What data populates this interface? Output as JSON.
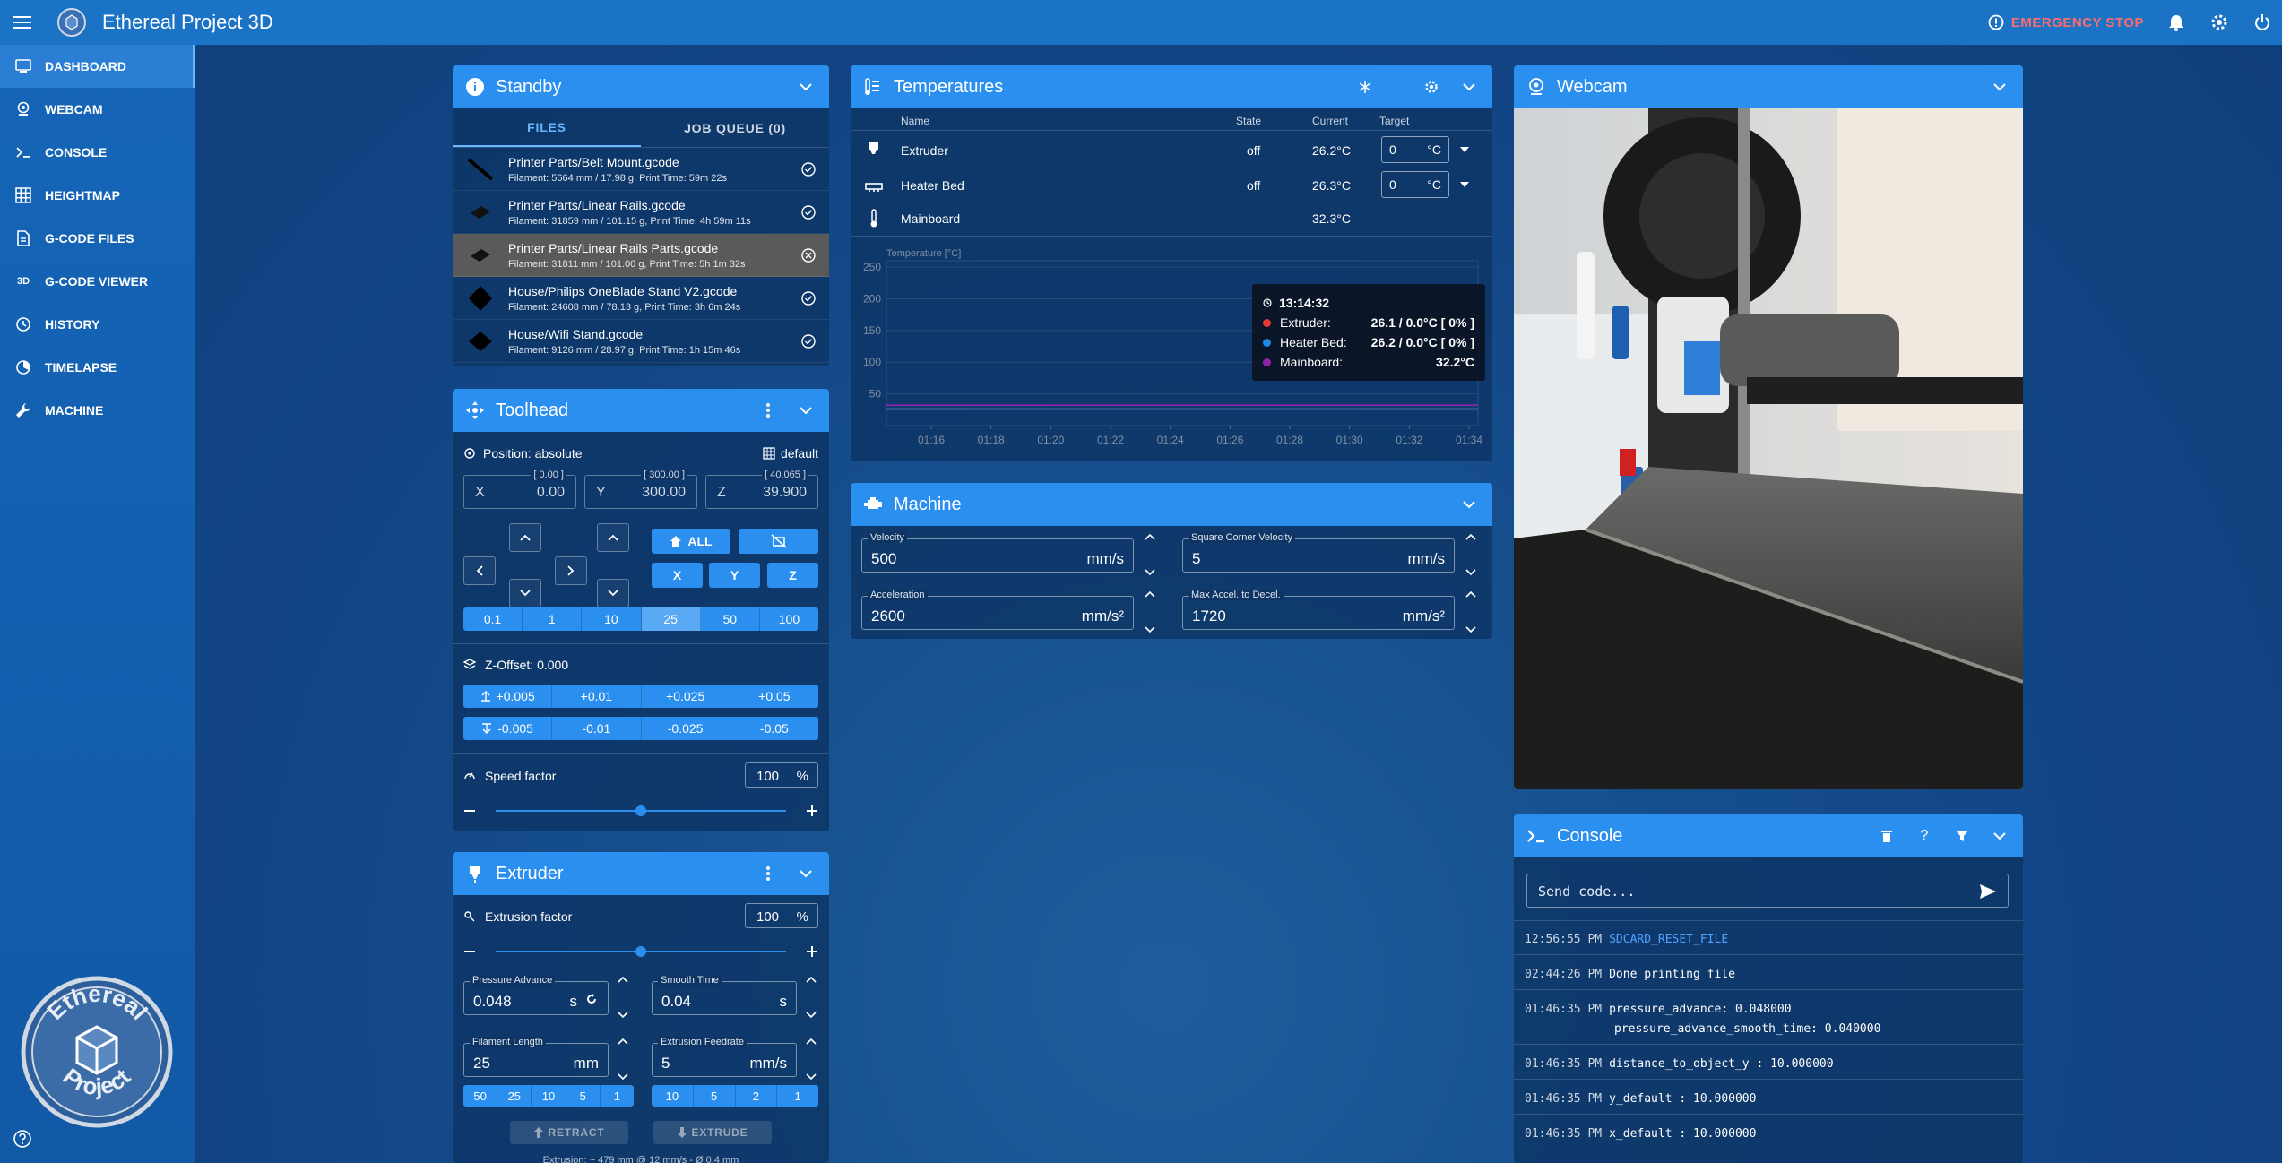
{
  "app": {
    "title": "Ethereal Project 3D",
    "emergency_stop": "EMERGENCY STOP"
  },
  "sidebar": {
    "items": [
      {
        "label": "DASHBOARD",
        "icon": "dashboard-icon"
      },
      {
        "label": "WEBCAM",
        "icon": "webcam-icon"
      },
      {
        "label": "CONSOLE",
        "icon": "console-icon"
      },
      {
        "label": "HEIGHTMAP",
        "icon": "grid-icon"
      },
      {
        "label": "G-CODE FILES",
        "icon": "file-icon"
      },
      {
        "label": "G-CODE VIEWER",
        "icon": "3d-icon",
        "icon_text": "3D"
      },
      {
        "label": "HISTORY",
        "icon": "history-icon"
      },
      {
        "label": "TIMELAPSE",
        "icon": "timelapse-icon"
      },
      {
        "label": "MACHINE",
        "icon": "wrench-icon"
      }
    ]
  },
  "status": {
    "title": "Standby",
    "tabs": [
      "FILES",
      "JOB QUEUE (0)"
    ],
    "files": [
      {
        "name": "Printer Parts/Belt Mount.gcode",
        "meta": "Filament: 5664 mm / 17.98 g, Print Time: 59m 22s"
      },
      {
        "name": "Printer Parts/Linear Rails.gcode",
        "meta": "Filament: 31859 mm / 101.15 g, Print Time: 4h 59m 11s"
      },
      {
        "name": "Printer Parts/Linear Rails Parts.gcode",
        "meta": "Filament: 31811 mm / 101.00 g, Print Time: 5h 1m 32s"
      },
      {
        "name": "House/Philips OneBlade Stand V2.gcode",
        "meta": "Filament: 24608 mm / 78.13 g, Print Time: 3h 6m 24s"
      },
      {
        "name": "House/Wifi Stand.gcode",
        "meta": "Filament: 9126 mm / 28.97 g, Print Time: 1h 15m 46s"
      }
    ]
  },
  "toolhead": {
    "title": "Toolhead",
    "position_mode": "Position: absolute",
    "profile": "default",
    "x": {
      "axis": "X",
      "value": "0.00",
      "cap": "[ 0.00 ]"
    },
    "y": {
      "axis": "Y",
      "value": "300.00",
      "cap": "[ 300.00 ]"
    },
    "z": {
      "axis": "Z",
      "value": "39.900",
      "cap": "[ 40.065 ]"
    },
    "home_all": "ALL",
    "home_x": "X",
    "home_y": "Y",
    "home_z": "Z",
    "steps": [
      "0.1",
      "1",
      "10",
      "25",
      "50",
      "100"
    ],
    "selected_step": "25",
    "z_offset": "Z-Offset: 0.000",
    "z_up": [
      "+0.005",
      "+0.01",
      "+0.025",
      "+0.05"
    ],
    "z_down": [
      "-0.005",
      "-0.01",
      "-0.025",
      "-0.05"
    ],
    "speed_label": "Speed factor",
    "speed_value": "100",
    "speed_unit": "%",
    "speed_fraction": 0.5
  },
  "extruder": {
    "title": "Extruder",
    "factor_label": "Extrusion factor",
    "factor_value": "100",
    "factor_unit": "%",
    "factor_fraction": 0.5,
    "pa_label": "Pressure Advance",
    "pa_value": "0.048",
    "pa_unit": "s",
    "smooth_label": "Smooth Time",
    "smooth_value": "0.04",
    "smooth_unit": "s",
    "length_label": "Filament Length",
    "length_value": "25",
    "length_unit": "mm",
    "feed_label": "Extrusion Feedrate",
    "feed_value": "5",
    "feed_unit": "mm/s",
    "length_presets": [
      "50",
      "25",
      "10",
      "5",
      "1"
    ],
    "feed_presets": [
      "10",
      "5",
      "2",
      "1"
    ],
    "retract": "RETRACT",
    "extrude": "EXTRUDE",
    "footer": "Extrusion: ~ 479 mm @ 12 mm/s - Ø 0.4 mm"
  },
  "temperatures": {
    "title": "Temperatures",
    "headers": {
      "name": "Name",
      "state": "State",
      "current": "Current",
      "target": "Target"
    },
    "rows": [
      {
        "name": "Extruder",
        "state": "off",
        "current": "26.2°C",
        "target": "0",
        "unit": "°C"
      },
      {
        "name": "Heater Bed",
        "state": "off",
        "current": "26.3°C",
        "target": "0",
        "unit": "°C"
      },
      {
        "name": "Mainboard",
        "state": "",
        "current": "32.3°C",
        "target": "",
        "unit": ""
      }
    ],
    "chart_label": "Temperature [°C]"
  },
  "chart_data": {
    "type": "line",
    "ylabel": "Temperature [°C]",
    "ylim": [
      0,
      260
    ],
    "yticks": [
      50,
      100,
      150,
      200,
      250
    ],
    "x": [
      "01:16",
      "01:18",
      "01:20",
      "01:22",
      "01:24",
      "01:26",
      "01:28",
      "01:30",
      "01:32",
      "01:34"
    ],
    "series": [
      {
        "name": "Extruder",
        "color": "#e53935",
        "values": [
          26.1,
          26.1,
          26.1,
          26.1,
          26.1,
          26.1,
          26.1,
          26.1,
          26.1,
          26.1
        ]
      },
      {
        "name": "Heater Bed",
        "color": "#1e88e5",
        "values": [
          26.2,
          26.2,
          26.2,
          26.2,
          26.2,
          26.2,
          26.2,
          26.2,
          26.2,
          26.2
        ]
      },
      {
        "name": "Mainboard",
        "color": "#8e24aa",
        "values": [
          32.2,
          32.2,
          32.2,
          32.2,
          32.2,
          32.2,
          32.2,
          32.2,
          32.2,
          32.2
        ]
      }
    ],
    "tooltip": {
      "time": "13:14:32",
      "rows": [
        {
          "name": "Extruder:",
          "value": "26.1 / 0.0°C [ 0% ]",
          "color": "#e53935"
        },
        {
          "name": "Heater Bed:",
          "value": "26.2 / 0.0°C [ 0% ]",
          "color": "#1e88e5"
        },
        {
          "name": "Mainboard:",
          "value": "32.2°C",
          "color": "#8e24aa"
        }
      ]
    }
  },
  "machine": {
    "title": "Machine",
    "velocity_label": "Velocity",
    "velocity_value": "500",
    "velocity_unit": "mm/s",
    "scv_label": "Square Corner Velocity",
    "scv_value": "5",
    "scv_unit": "mm/s",
    "accel_label": "Acceleration",
    "accel_value": "2600",
    "accel_unit": "mm/s²",
    "decel_label": "Max Accel. to Decel.",
    "decel_value": "1720",
    "decel_unit": "mm/s²"
  },
  "webcam": {
    "title": "Webcam"
  },
  "console": {
    "title": "Console",
    "placeholder": "Send code...",
    "lines": [
      {
        "ts": "12:56:55 PM",
        "msg": "SDCARD_RESET_FILE",
        "color": "#4ea3ff"
      },
      {
        "ts": "02:44:26 PM",
        "msg": "Done printing file",
        "color": "#ffffff"
      },
      {
        "ts": "01:46:35 PM",
        "msg": "pressure_advance: 0.048000",
        "msg2": "pressure_advance_smooth_time: 0.040000",
        "color": "#ffffff"
      },
      {
        "ts": "01:46:35 PM",
        "msg": "distance_to_object_y : 10.000000",
        "color": "#ffffff"
      },
      {
        "ts": "01:46:35 PM",
        "msg": "y_default : 10.000000",
        "color": "#ffffff"
      },
      {
        "ts": "01:46:35 PM",
        "msg": "x_default : 10.000000",
        "color": "#ffffff"
      }
    ]
  }
}
